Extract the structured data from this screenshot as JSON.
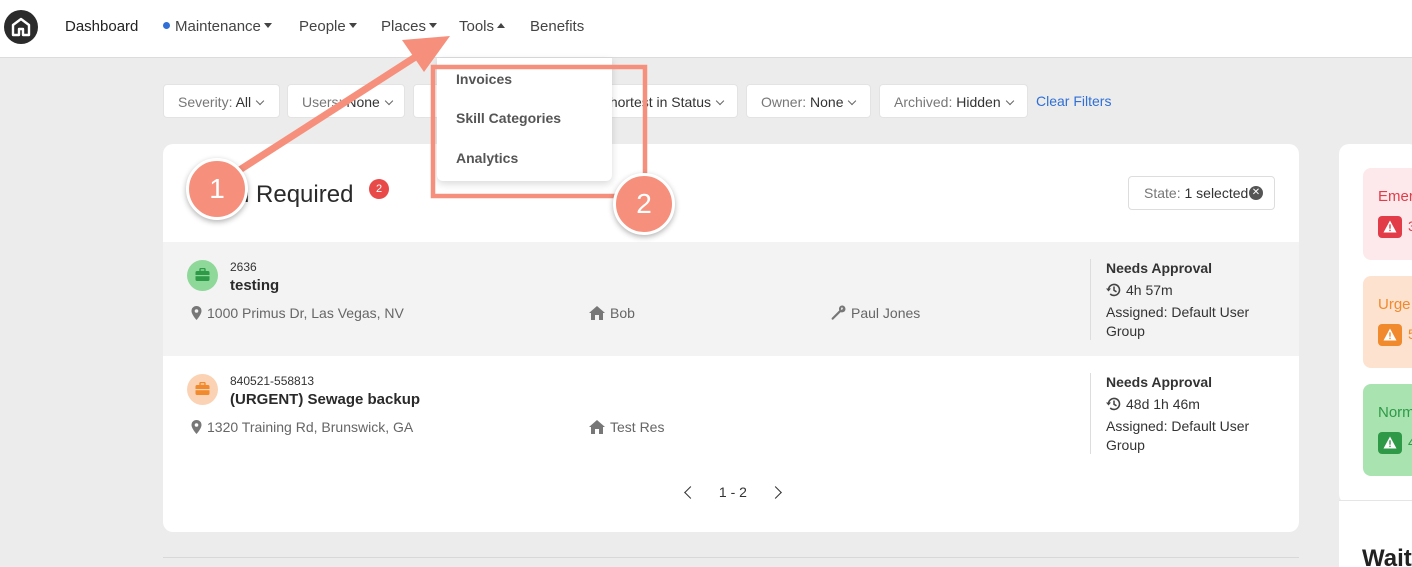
{
  "nav": {
    "items": [
      {
        "label": "Dashboard"
      },
      {
        "label": "Maintenance"
      },
      {
        "label": "People"
      },
      {
        "label": "Places"
      },
      {
        "label": "Tools"
      },
      {
        "label": "Benefits"
      }
    ],
    "active_dot_color": "#2f6fd6"
  },
  "filters": {
    "severity": {
      "label": "Severity:",
      "value": "All"
    },
    "users": {
      "label": "Users:",
      "value": "None"
    },
    "sort": {
      "value": "Shortest in Status"
    },
    "owner": {
      "label": "Owner:",
      "value": "None"
    },
    "archived": {
      "label": "Archived:",
      "value": "Hidden"
    },
    "clear_label": "Clear Filters"
  },
  "tools_menu": {
    "items": [
      "Invoices",
      "Skill Categories",
      "Analytics"
    ]
  },
  "section": {
    "title": "n Required",
    "count": "2",
    "state_filter": {
      "label": "State:",
      "value": "1 selected"
    }
  },
  "work_orders": [
    {
      "number": "2636",
      "title": "testing",
      "address": "1000 Primus Dr, Las Vegas, NV",
      "resident": "Bob",
      "technician": "Paul Jones",
      "status": "Needs Approval",
      "duration": "4h 57m",
      "assigned": "Assigned: Default User Group",
      "icon_color": "#8ed89a"
    },
    {
      "number": "840521-558813",
      "title": "(URGENT) Sewage backup",
      "address": "1320 Training Rd, Brunswick, GA",
      "resident": "Test Res",
      "technician": "",
      "status": "Needs Approval",
      "duration": "48d 1h 46m",
      "assigned": "Assigned: Default User Group",
      "icon_color": "#fbd3b4"
    }
  ],
  "pagination": {
    "range": "1 - 2"
  },
  "severity_panel": {
    "emergency": {
      "label": "Emer",
      "count": "3"
    },
    "urgent": {
      "label": "Urge",
      "count": "5"
    },
    "normal": {
      "label": "Norm",
      "count": "4"
    }
  },
  "side_heading": "Wait",
  "annotations": {
    "marker_1": "1",
    "marker_2": "2",
    "color": "#f6907c"
  }
}
